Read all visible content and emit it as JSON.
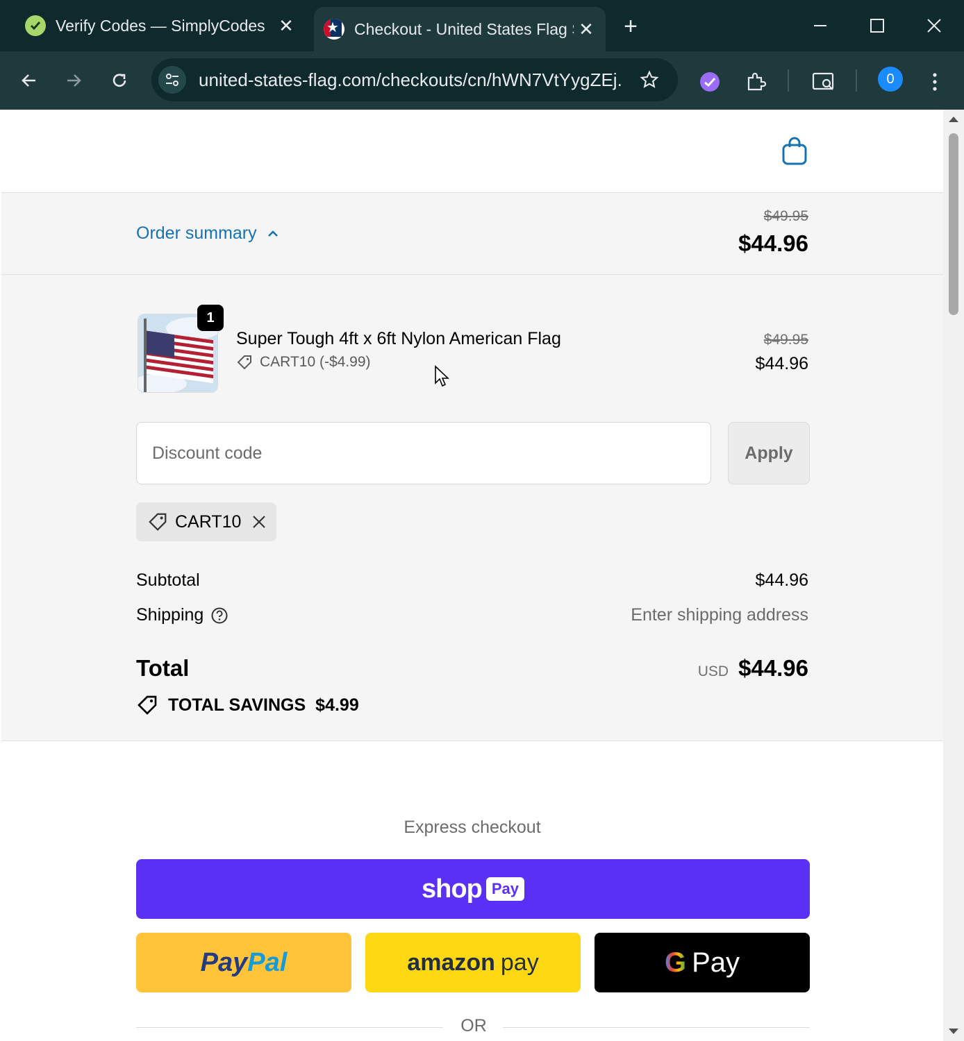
{
  "browser": {
    "tabs": [
      {
        "title": "Verify Codes — SimplyCodes",
        "favicon": "simplycodes-icon",
        "active": false
      },
      {
        "title": "Checkout - United States Flag S",
        "favicon": "flag-store-icon",
        "active": true
      }
    ],
    "address": "united-states-flag.com/checkouts/cn/hWN7VtYygZEj...",
    "profile_initial": "0"
  },
  "order_summary": {
    "toggle_label": "Order summary",
    "original_total": "$49.95",
    "total": "$44.96"
  },
  "item": {
    "quantity": "1",
    "title": "Super Tough 4ft x 6ft Nylon American Flag",
    "discount": "CART10 (-$4.99)",
    "original_price": "$49.95",
    "price": "$44.96"
  },
  "discount": {
    "placeholder": "Discount code",
    "apply_label": "Apply",
    "applied_code": "CART10"
  },
  "totals": {
    "subtotal_label": "Subtotal",
    "subtotal_value": "$44.96",
    "shipping_label": "Shipping",
    "shipping_value": "Enter shipping address",
    "total_label": "Total",
    "currency": "USD",
    "total_value": "$44.96",
    "savings_label": "TOTAL SAVINGS",
    "savings_value": "$4.99"
  },
  "express": {
    "title": "Express checkout",
    "shop_word": "shop",
    "shop_pay": "Pay",
    "paypal_1": "Pay",
    "paypal_2": "Pal",
    "amazon_1": "amazon",
    "amazon_2": "pay",
    "gpay_g": "G",
    "gpay_pay": "Pay",
    "or_label": "OR"
  },
  "colors": {
    "link": "#1773b0",
    "shop_pay": "#5a31f4",
    "paypal": "#ffc439",
    "amazon_pay": "#ffd814",
    "google_pay": "#000000"
  }
}
